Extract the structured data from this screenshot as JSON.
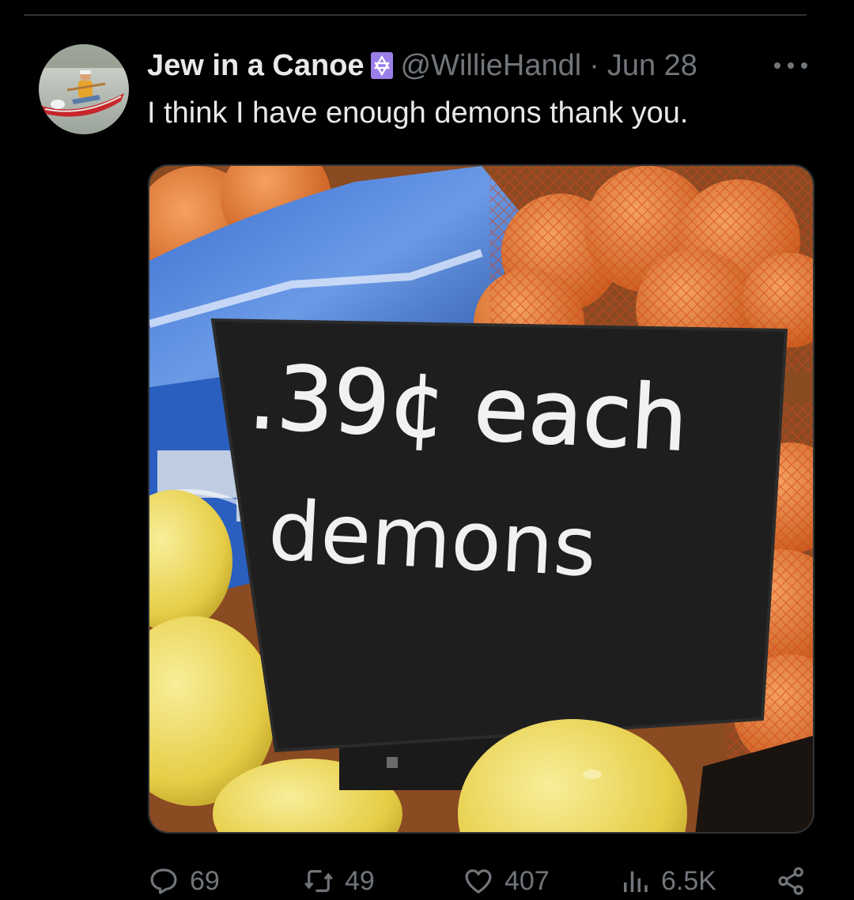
{
  "tweet": {
    "author": {
      "display_name": "Jew in a Canoe",
      "handle": "@WillieHandl",
      "badge_icon": "star-of-david-icon",
      "avatar_icon": "canoe-avatar"
    },
    "separator": "·",
    "date": "Jun 28",
    "more_icon": "more-dots-icon",
    "text": "I think I have enough demons thank you.",
    "media": {
      "sign_line1": ".39¢ each",
      "sign_line2": "demons"
    },
    "actions": {
      "replies": {
        "icon": "reply-icon",
        "count": "69"
      },
      "reposts": {
        "icon": "repost-icon",
        "count": "49"
      },
      "likes": {
        "icon": "heart-icon",
        "count": "407"
      },
      "views": {
        "icon": "views-icon",
        "count": "6.5K"
      },
      "share": {
        "icon": "share-icon"
      }
    }
  },
  "colors": {
    "background": "#000000",
    "primary_text": "#e7e9ea",
    "secondary_text": "#71767b",
    "divider": "#2f3336",
    "badge": "#9b7ee8"
  }
}
